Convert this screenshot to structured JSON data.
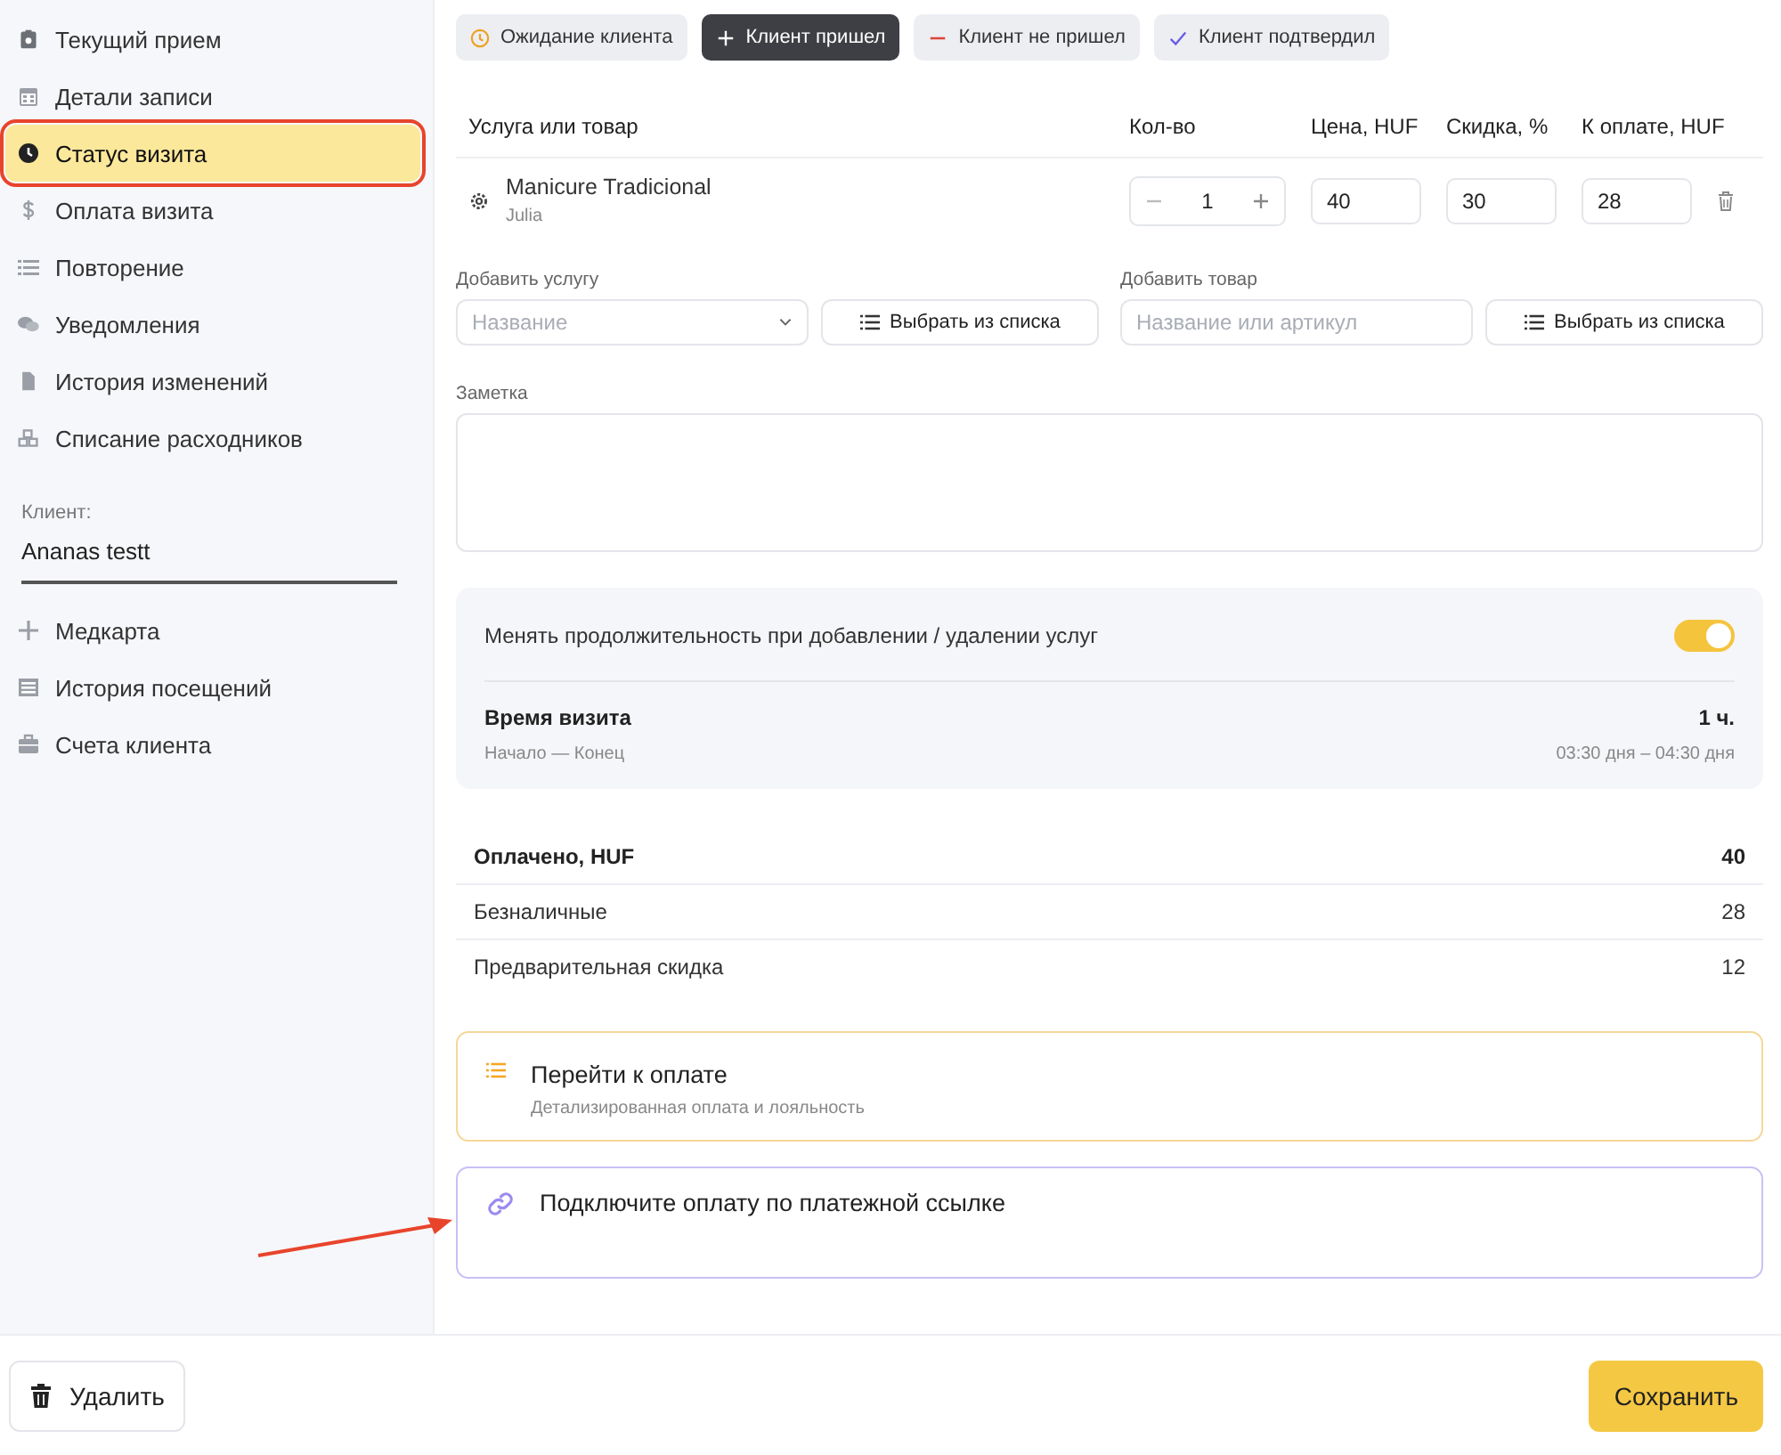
{
  "sidebar": {
    "items": [
      {
        "label": "Текущий прием",
        "selected": false,
        "highlighted": false
      },
      {
        "label": "Детали записи",
        "selected": false,
        "highlighted": false
      },
      {
        "label": "Статус визита",
        "selected": true,
        "highlighted": true
      },
      {
        "label": "Оплата визита",
        "selected": false,
        "highlighted": false
      },
      {
        "label": "Повторение",
        "selected": false,
        "highlighted": false
      },
      {
        "label": "Уведомления",
        "selected": false,
        "highlighted": false
      },
      {
        "label": "История изменений",
        "selected": false,
        "highlighted": false
      },
      {
        "label": "Списание расходников",
        "selected": false,
        "highlighted": false
      }
    ],
    "client": {
      "label": "Клиент:",
      "value": "Ananas testt"
    },
    "client_items": [
      {
        "label": "Медкарта",
        "selected": false
      },
      {
        "label": "История посещений",
        "selected": false
      },
      {
        "label": "Счета клиента",
        "selected": false
      }
    ]
  },
  "status_buttons": [
    {
      "kind": "waiting",
      "label": "Ожидание клиента",
      "selected": false
    },
    {
      "kind": "arrived",
      "label": "Клиент пришел",
      "selected": true
    },
    {
      "kind": "absent",
      "label": "Клиент не пришел",
      "selected": false
    },
    {
      "kind": "confirmed",
      "label": "Клиент подтвердил",
      "selected": false
    }
  ],
  "table": {
    "columns": [
      "Услуга или товар",
      "Кол-во",
      "Цена, HUF",
      "Скидка, %",
      "К оплате, HUF"
    ],
    "rows": [
      {
        "name": "Manicure Tradicional",
        "staff": "Julia",
        "quantity": "1",
        "price": "40",
        "discount": "30",
        "total": "28"
      }
    ]
  },
  "add_service": {
    "label": "Добавить услугу",
    "placeholder": "Название",
    "button": "Выбрать из списка"
  },
  "add_product": {
    "label": "Добавить товар",
    "placeholder": "Название или артикул",
    "button": "Выбрать из списка"
  },
  "note": {
    "label": "Заметка"
  },
  "duration_panel": {
    "toggle_label": "Менять продолжительность при добавлении / удалении услуг",
    "toggle_on": true,
    "visit_time_label": "Время визита",
    "visit_time_value": "1 ч.",
    "range_label": "Начало — Конец",
    "range_value": "03:30 дня – 04:30 дня"
  },
  "summary": [
    {
      "label": "Оплачено, HUF",
      "value": "40",
      "bold": true
    },
    {
      "label": "Безналичные",
      "value": "28",
      "bold": false
    },
    {
      "label": "Предварительная скидка",
      "value": "12",
      "bold": false
    }
  ],
  "payment_card": {
    "title": "Перейти к оплате",
    "subtitle": "Детализированная оплата и лояльность"
  },
  "link_card": {
    "title": "Подключите оплату по платежной ссылке"
  },
  "footer": {
    "delete_button": "Удалить",
    "save_button": "Сохранить"
  }
}
